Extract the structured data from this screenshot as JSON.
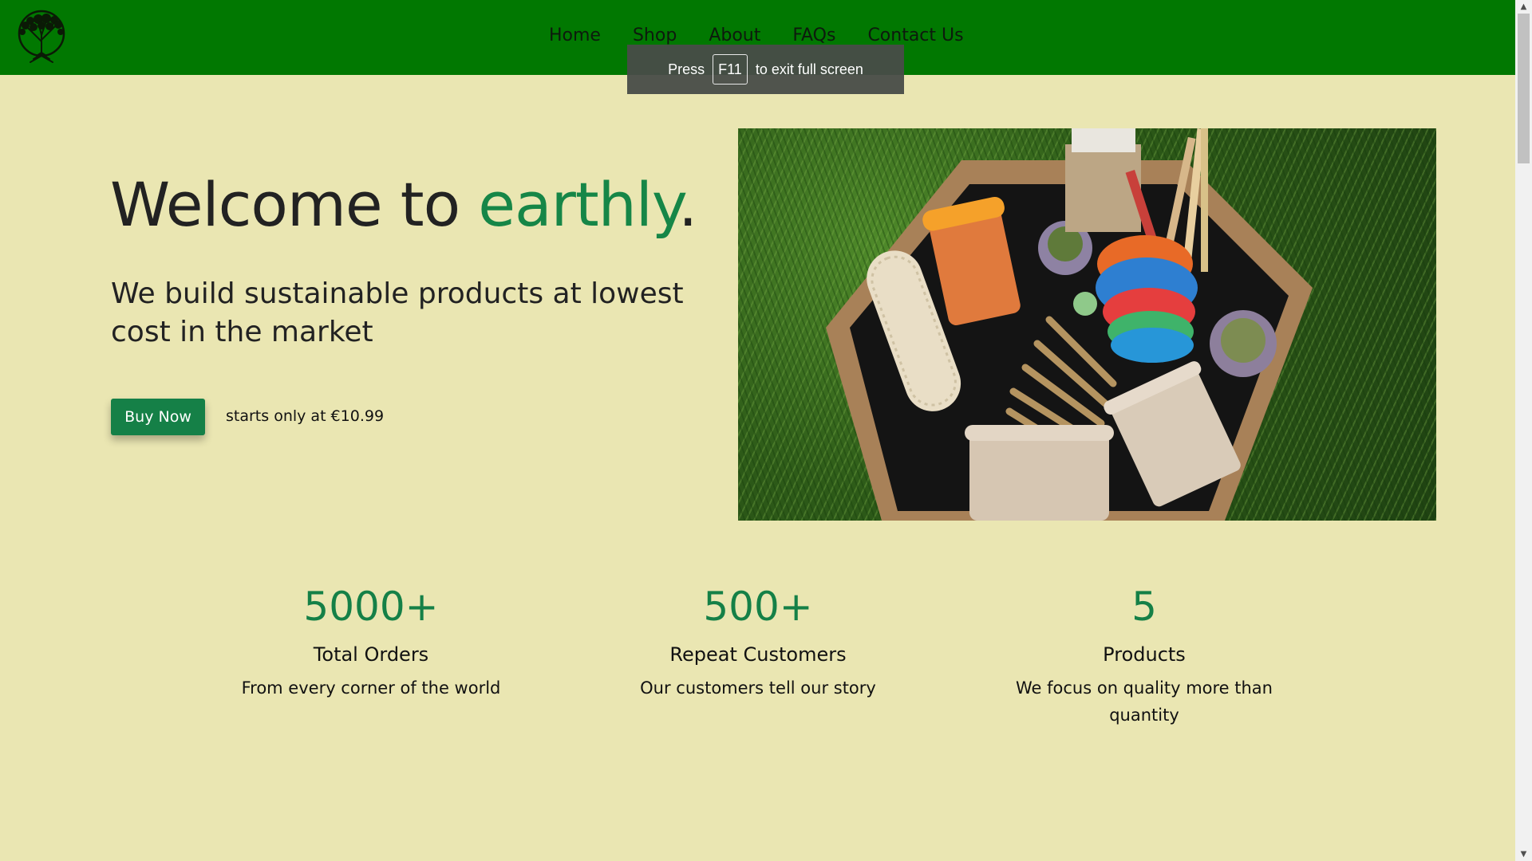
{
  "nav": {
    "items": [
      {
        "label": "Home"
      },
      {
        "label": "Shop"
      },
      {
        "label": "About"
      },
      {
        "label": "FAQs"
      },
      {
        "label": "Contact Us"
      }
    ]
  },
  "toast": {
    "press": "Press",
    "key": "F11",
    "rest": "to exit full screen"
  },
  "hero": {
    "title_prefix": "Welcome to ",
    "title_brand": "earthly",
    "title_suffix": ".",
    "subtitle": "We build sustainable products at lowest cost in the market",
    "button_label": "Buy Now",
    "price_note": "starts only at €10.99"
  },
  "stats": [
    {
      "number": "5000+",
      "label": "Total Orders",
      "desc": "From every corner of the world"
    },
    {
      "number": "500+",
      "label": "Repeat Customers",
      "desc": "Our customers tell our story"
    },
    {
      "number": "5",
      "label": "Products",
      "desc": "We focus on quality more than quantity"
    }
  ],
  "colors": {
    "header_bg": "#017801",
    "page_bg": "#eae6b2",
    "brand_green": "#158047"
  },
  "icons": {
    "logo": "tree-logo-icon",
    "scroll_up": "arrow-up-icon",
    "scroll_down": "arrow-down-icon"
  }
}
